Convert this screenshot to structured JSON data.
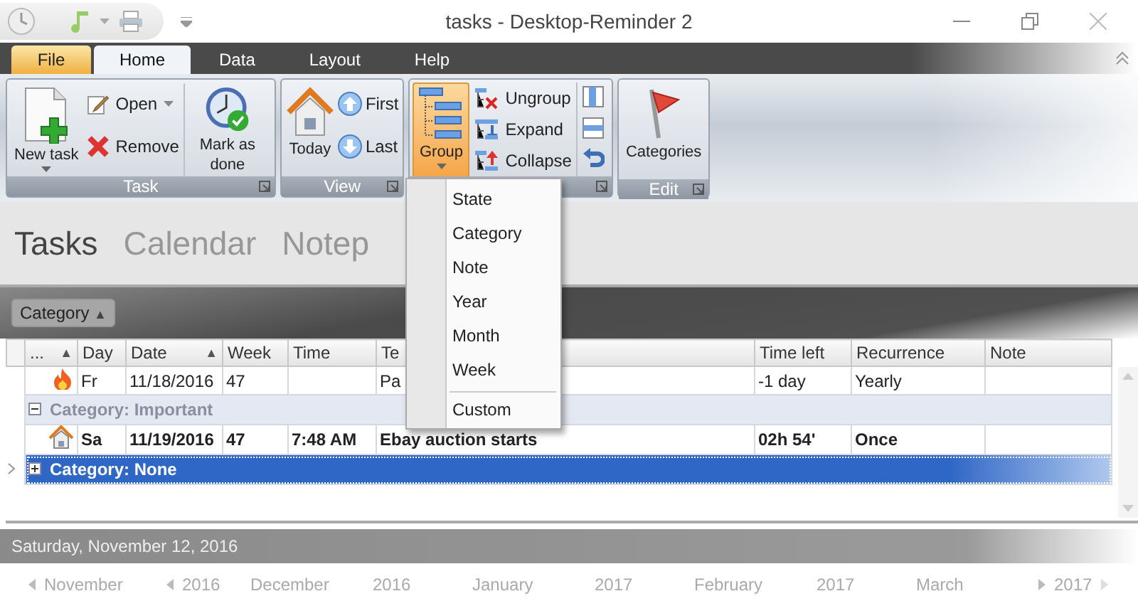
{
  "window": {
    "title": "tasks - Desktop-Reminder 2"
  },
  "menu_tabs": [
    {
      "label": "File",
      "selected": false,
      "kind": "file"
    },
    {
      "label": "Home",
      "selected": true,
      "kind": "tab"
    },
    {
      "label": "Data",
      "selected": false,
      "kind": "tab"
    },
    {
      "label": "Layout",
      "selected": false,
      "kind": "tab"
    },
    {
      "label": "Help",
      "selected": false,
      "kind": "tab"
    }
  ],
  "ribbon_groups": [
    {
      "title": "Task",
      "items": [
        {
          "kind": "large",
          "label": "New task",
          "dropdown": true
        },
        {
          "kind": "small",
          "label": "Open",
          "dropdown": true
        },
        {
          "kind": "small",
          "label": "Remove",
          "dropdown": false
        },
        {
          "kind": "large",
          "label": "Mark as done",
          "dropdown": false
        }
      ]
    },
    {
      "title": "View",
      "items": [
        {
          "kind": "large",
          "label": "Today",
          "dropdown": false
        },
        {
          "kind": "small",
          "label": "First",
          "dropdown": false
        },
        {
          "kind": "small",
          "label": "Last",
          "dropdown": false
        }
      ]
    },
    {
      "items": [
        {
          "kind": "large",
          "label": "Group",
          "dropdown": true,
          "pressed": true
        },
        {
          "kind": "small",
          "label": "Ungroup",
          "dropdown": false
        },
        {
          "kind": "small",
          "label": "Expand",
          "dropdown": false
        },
        {
          "kind": "small",
          "label": "Collapse",
          "dropdown": false
        },
        {
          "kind": "iconcol"
        }
      ]
    },
    {
      "title": "Edit",
      "items": [
        {
          "kind": "large",
          "label": "Categories",
          "dropdown": false
        }
      ]
    }
  ],
  "view_tabs": [
    {
      "label": "Tasks",
      "selected": true
    },
    {
      "label": "Calendar",
      "selected": false
    },
    {
      "label": "Notep",
      "selected": false
    }
  ],
  "group_panel": {
    "chip": "Category",
    "sort_mark": "▲"
  },
  "grid": {
    "columns": [
      {
        "label": "...",
        "sort_mark": "▲"
      },
      {
        "label": "Day"
      },
      {
        "label": "Date",
        "sort_mark": "▲"
      },
      {
        "label": "Week"
      },
      {
        "label": "Time"
      },
      {
        "label": "Te"
      },
      {
        "label": "Time left"
      },
      {
        "label": "Recurrence"
      },
      {
        "label": "Note"
      }
    ],
    "rows": [
      {
        "kind": "task",
        "bold": false,
        "cells": [
          "Fr",
          "11/18/2016",
          "47",
          "",
          "Pa",
          "-1 day",
          "Yearly",
          ""
        ]
      },
      {
        "kind": "group",
        "label": "Category: Important",
        "expanded": true,
        "selected": false
      },
      {
        "kind": "task",
        "bold": true,
        "cells": [
          "Sa",
          "11/19/2016",
          "47",
          "7:48 AM",
          "Ebay auction starts",
          "02h 54'",
          "Once",
          ""
        ]
      },
      {
        "kind": "group",
        "label": "Category: None",
        "expanded": false,
        "selected": true
      }
    ]
  },
  "dropdown_menu": [
    {
      "label": "State",
      "separator_before": false
    },
    {
      "label": "Category",
      "separator_before": false
    },
    {
      "label": "Note",
      "separator_before": false
    },
    {
      "label": "Year",
      "separator_before": false
    },
    {
      "label": "Month",
      "separator_before": false
    },
    {
      "label": "Week",
      "separator_before": false
    },
    {
      "label": "Custom",
      "separator_before": true
    }
  ],
  "date_bar": {
    "date": "Saturday, November 12, 2016"
  },
  "calendar_strip": [
    {
      "month": "November",
      "year": "2016"
    },
    {
      "month": "December",
      "year": "2016"
    },
    {
      "month": "January",
      "year": "2017"
    },
    {
      "month": "February",
      "year": "2017"
    },
    {
      "month": "March",
      "year": "2017"
    }
  ]
}
